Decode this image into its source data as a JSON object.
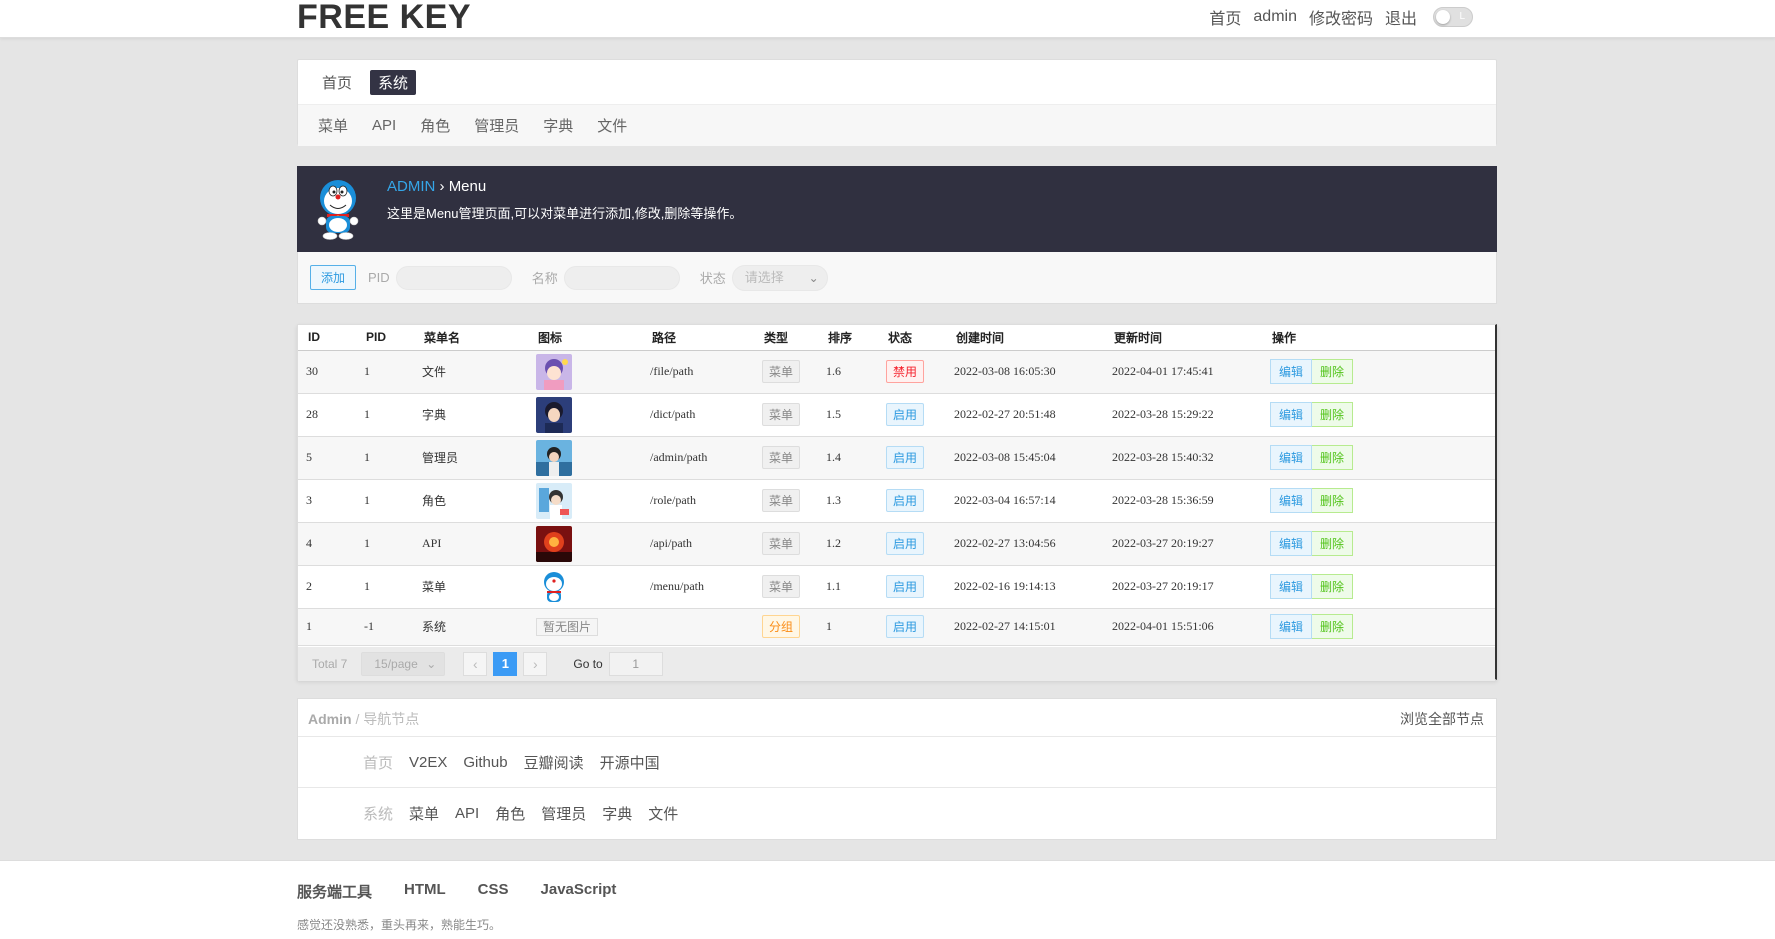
{
  "header": {
    "brand": "FREE KEY",
    "nav": [
      "首页",
      "admin",
      "修改密码",
      "退出"
    ],
    "toggle_label": "L"
  },
  "topnav": {
    "level1": [
      {
        "label": "首页",
        "active": false
      },
      {
        "label": "系统",
        "active": true
      }
    ],
    "level2": [
      "菜单",
      "API",
      "角色",
      "管理员",
      "字典",
      "文件"
    ]
  },
  "banner": {
    "crumb_root": "ADMIN",
    "crumb_sep": "›",
    "crumb_page": "Menu",
    "description": "这里是Menu管理页面,可以对菜单进行添加,修改,删除等操作。"
  },
  "filter": {
    "add_label": "添加",
    "pid_label": "PID",
    "name_label": "名称",
    "status_label": "状态",
    "status_placeholder": "请选择"
  },
  "table": {
    "columns": [
      "ID",
      "PID",
      "菜单名",
      "图标",
      "路径",
      "类型",
      "排序",
      "状态",
      "创建时间",
      "更新时间",
      "操作"
    ],
    "rows": [
      {
        "id": "30",
        "pid": "1",
        "name": "文件",
        "icon": "anime-girl-thumb",
        "path": "/file/path",
        "type": "菜单",
        "sort": "1.6",
        "status": "禁用",
        "created": "2022-03-08 16:05:30",
        "updated": "2022-04-01 17:45:41"
      },
      {
        "id": "28",
        "pid": "1",
        "name": "字典",
        "icon": "anime-boy-thumb",
        "path": "/dict/path",
        "type": "菜单",
        "sort": "1.5",
        "status": "启用",
        "created": "2022-02-27 20:51:48",
        "updated": "2022-03-28 15:29:22"
      },
      {
        "id": "5",
        "pid": "1",
        "name": "管理员",
        "icon": "sky-character-thumb",
        "path": "/admin/path",
        "type": "菜单",
        "sort": "1.4",
        "status": "启用",
        "created": "2022-03-08 15:45:04",
        "updated": "2022-03-28 15:40:32"
      },
      {
        "id": "3",
        "pid": "1",
        "name": "角色",
        "icon": "light-character-thumb",
        "path": "/role/path",
        "type": "菜单",
        "sort": "1.3",
        "status": "启用",
        "created": "2022-03-04 16:57:14",
        "updated": "2022-03-28 15:36:59"
      },
      {
        "id": "4",
        "pid": "1",
        "name": "API",
        "icon": "red-sky-thumb",
        "path": "/api/path",
        "type": "菜单",
        "sort": "1.2",
        "status": "启用",
        "created": "2022-02-27 13:04:56",
        "updated": "2022-03-27 20:19:27"
      },
      {
        "id": "2",
        "pid": "1",
        "name": "菜单",
        "icon": "doraemon-thumb",
        "path": "/menu/path",
        "type": "菜单",
        "sort": "1.1",
        "status": "启用",
        "created": "2022-02-16 19:14:13",
        "updated": "2022-03-27 20:19:17"
      },
      {
        "id": "1",
        "pid": "-1",
        "name": "系统",
        "icon": "none",
        "no_image": "暂无图片",
        "path": "",
        "type": "分组",
        "sort": "1",
        "status": "启用",
        "created": "2022-02-27 14:15:01",
        "updated": "2022-04-01 15:51:06"
      }
    ],
    "edit_label": "编辑",
    "delete_label": "删除"
  },
  "pager": {
    "total": "Total 7",
    "page_size": "15/page",
    "prev": "‹",
    "current": "1",
    "next": "›",
    "goto_label": "Go to",
    "goto_value": "1"
  },
  "sitemap": {
    "title_root": "Admin",
    "title_sep": " / ",
    "title_page": "导航节点",
    "browse_all": "浏览全部节点",
    "rows": [
      {
        "head": "首页",
        "items": [
          "V2EX",
          "Github",
          "豆瓣阅读",
          "开源中国"
        ]
      },
      {
        "head": "系统",
        "items": [
          "菜单",
          "API",
          "角色",
          "管理员",
          "字典",
          "文件"
        ]
      }
    ]
  },
  "footer": {
    "links": [
      "服务端工具",
      "HTML",
      "CSS",
      "JavaScript"
    ],
    "note": "感觉还没熟悉，重头再来，熟能生巧。"
  },
  "colors": {
    "banner_bg": "#303040",
    "accent_blue": "#35a6e8",
    "pager_active": "#3b9bf5",
    "danger": "#f5222d",
    "success": "#52c41a"
  }
}
